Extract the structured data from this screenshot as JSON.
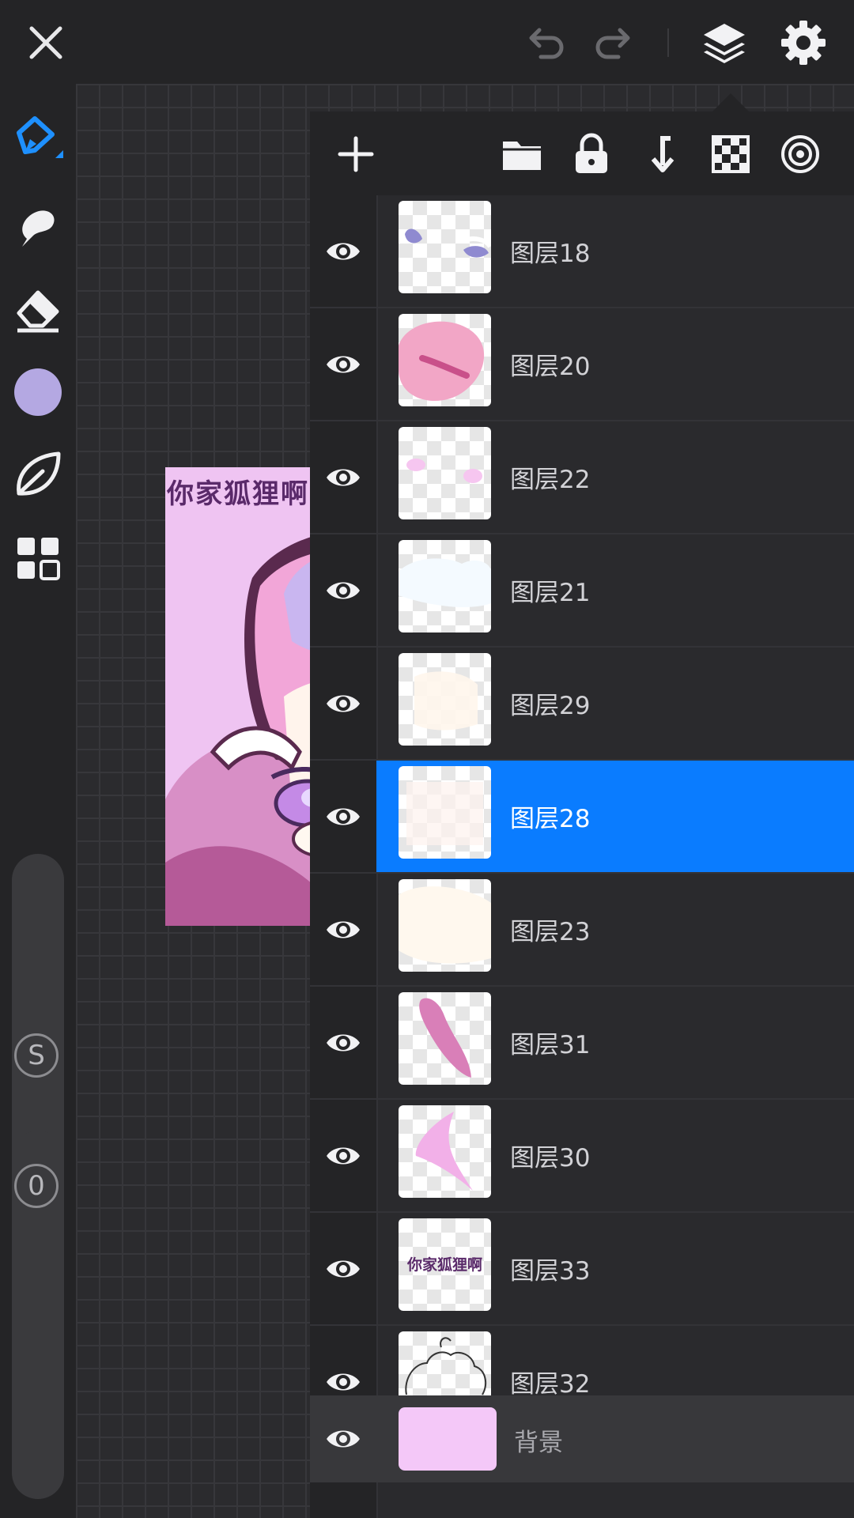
{
  "topbar": {
    "icons": [
      "close-icon",
      "undo-icon",
      "redo-icon",
      "layers-icon",
      "settings-icon"
    ]
  },
  "toolbar": {
    "tools": [
      "pen-icon",
      "smudge-icon",
      "eraser-icon",
      "color-swatch",
      "leaf-icon",
      "grid-icon"
    ],
    "color": "#b4a8e2",
    "size_badge": "S",
    "opacity_badge": "0"
  },
  "artwork": {
    "title": "你家狐狸啊",
    "background": "#efc4f2"
  },
  "layers_panel": {
    "actions": [
      "add-icon",
      "folder-icon",
      "lock-icon",
      "merge-down-icon",
      "transparency-icon",
      "target-icon"
    ],
    "layers": [
      {
        "name": "图层18",
        "selected": false
      },
      {
        "name": "图层20",
        "selected": false
      },
      {
        "name": "图层22",
        "selected": false
      },
      {
        "name": "图层21",
        "selected": false
      },
      {
        "name": "图层29",
        "selected": false
      },
      {
        "name": "图层28",
        "selected": true
      },
      {
        "name": "图层23",
        "selected": false
      },
      {
        "name": "图层31",
        "selected": false
      },
      {
        "name": "图层30",
        "selected": false
      },
      {
        "name": "图层33",
        "selected": false,
        "thumb_text": "你家狐狸啊"
      },
      {
        "name": "图层32",
        "selected": false
      }
    ],
    "background_layer": {
      "name": "背景",
      "color": "#f4c8f8"
    },
    "accent": "#0a7cff"
  }
}
